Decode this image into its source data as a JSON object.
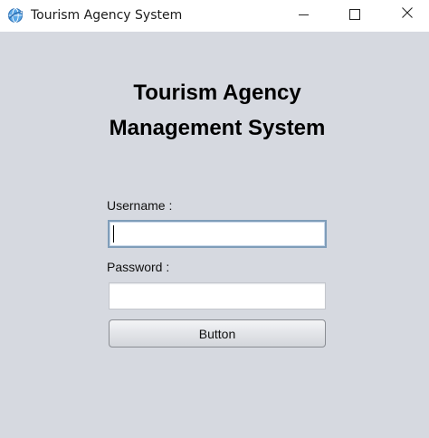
{
  "window": {
    "title": "Tourism Agency System",
    "icon": "globe-icon",
    "controls": [
      "minimize-icon",
      "maximize-icon",
      "close-icon"
    ]
  },
  "form": {
    "heading_line1": "Tourism Agency",
    "heading_line2": "Management System",
    "username_label": "Username :",
    "username_value": "",
    "password_label": "Password :",
    "password_value": "",
    "button_label": "Button"
  },
  "colors": {
    "background": "#d6d9e0",
    "titlebar": "#ffffff",
    "focus_border": "#7f9db9"
  }
}
